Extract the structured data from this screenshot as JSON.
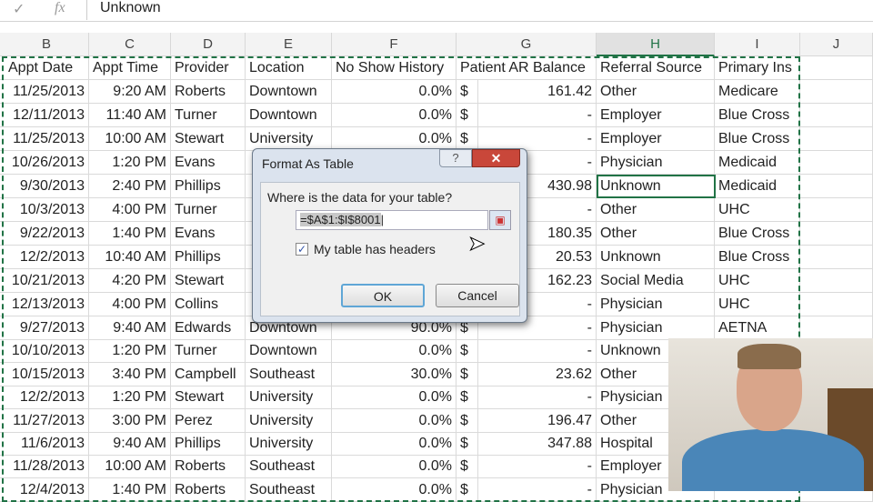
{
  "formula_bar": {
    "enter_icon": "check-icon",
    "function_icon": "fx-icon",
    "fx_label": "fx",
    "value": "Unknown"
  },
  "columns": [
    "B",
    "C",
    "D",
    "E",
    "F",
    "G",
    "H",
    "I",
    "J"
  ],
  "selected_column": "H",
  "headers": [
    "Appt Date",
    "Appt Time",
    "Provider",
    "Location",
    "No Show History",
    "Patient AR Balance",
    "Referral Source",
    "Primary Ins"
  ],
  "rows": [
    [
      "11/25/2013",
      "9:20 AM",
      "Roberts",
      "Downtown",
      "0.0%",
      "$",
      "161.42",
      "Other",
      "Medicare"
    ],
    [
      "12/11/2013",
      "11:40 AM",
      "Turner",
      "Downtown",
      "0.0%",
      "$",
      "-",
      "Employer",
      "Blue Cross"
    ],
    [
      "11/25/2013",
      "10:00 AM",
      "Stewart",
      "University",
      "0.0%",
      "$",
      "-",
      "Employer",
      "Blue Cross"
    ],
    [
      "10/26/2013",
      "1:20 PM",
      "Evans",
      "",
      "",
      "",
      "-",
      "Physician",
      "Medicaid"
    ],
    [
      "9/30/2013",
      "2:40 PM",
      "Phillips",
      "",
      "",
      "",
      "430.98",
      "Unknown",
      "Medicaid"
    ],
    [
      "10/3/2013",
      "4:00 PM",
      "Turner",
      "",
      "",
      "",
      "-",
      "Other",
      "UHC"
    ],
    [
      "9/22/2013",
      "1:40 PM",
      "Evans",
      "",
      "",
      "",
      "180.35",
      "Other",
      "Blue Cross"
    ],
    [
      "12/2/2013",
      "10:40 AM",
      "Phillips",
      "",
      "",
      "",
      "20.53",
      "Unknown",
      "Blue Cross"
    ],
    [
      "10/21/2013",
      "4:20 PM",
      "Stewart",
      "",
      "",
      "",
      "162.23",
      "Social Media",
      "UHC"
    ],
    [
      "12/13/2013",
      "4:00 PM",
      "Collins",
      "",
      "",
      "",
      "-",
      "Physician",
      "UHC"
    ],
    [
      "9/27/2013",
      "9:40 AM",
      "Edwards",
      "Downtown",
      "90.0%",
      "$",
      "-",
      "Physician",
      "AETNA"
    ],
    [
      "10/10/2013",
      "1:20 PM",
      "Turner",
      "Downtown",
      "0.0%",
      "$",
      "-",
      "Unknown",
      ""
    ],
    [
      "10/15/2013",
      "3:40 PM",
      "Campbell",
      "Southeast",
      "30.0%",
      "$",
      "23.62",
      "Other",
      ""
    ],
    [
      "12/2/2013",
      "1:20 PM",
      "Stewart",
      "University",
      "0.0%",
      "$",
      "-",
      "Physician",
      ""
    ],
    [
      "11/27/2013",
      "3:00 PM",
      "Perez",
      "University",
      "0.0%",
      "$",
      "196.47",
      "Other",
      ""
    ],
    [
      "11/6/2013",
      "9:40 AM",
      "Phillips",
      "University",
      "0.0%",
      "$",
      "347.88",
      "Hospital",
      ""
    ],
    [
      "11/28/2013",
      "10:00 AM",
      "Roberts",
      "Southeast",
      "0.0%",
      "$",
      "-",
      "Employer",
      ""
    ],
    [
      "12/4/2013",
      "1:40 PM",
      "Roberts",
      "Southeast",
      "0.0%",
      "$",
      "-",
      "Physician",
      ""
    ]
  ],
  "dialog": {
    "title": "Format As Table",
    "help": "?",
    "close": "✕",
    "question": "Where is the data for your table?",
    "range": "=$A$1:$I$8001",
    "range_picker_icon": "collapse-dialog-icon",
    "headers_checkbox": "My table has headers",
    "headers_checked": true,
    "check": "✓",
    "ok": "OK",
    "cancel": "Cancel"
  },
  "accent": "#217346"
}
